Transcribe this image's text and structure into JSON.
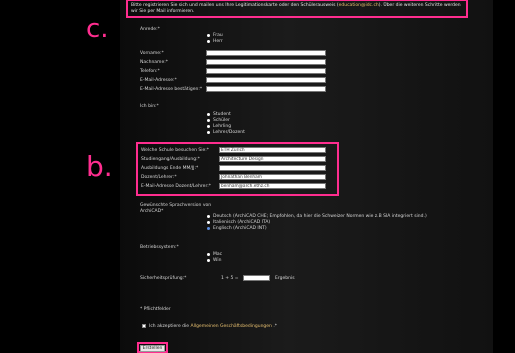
{
  "annotations": {
    "c": "c.",
    "b": "b."
  },
  "notice": {
    "text_before": "Bitte registrieren Sie sich und mailen uns Ihre Legitimationskarte oder den Schülerausweis (",
    "email": "education@idc.ch",
    "text_after": "). Über die weiteren Schritte werden wir Sie per Mail informieren."
  },
  "anrede": {
    "label": "Anrede:*",
    "options": [
      "Frau",
      "Herr"
    ]
  },
  "personal": {
    "vorname": "Vorname:*",
    "nachname": "Nachname:*",
    "telefon": "Telefon:*",
    "email": "E-Mail-Adresse:*",
    "email_confirm": "E-Mail-Adresse bestätigen:*"
  },
  "ichbin": {
    "label": "Ich bin:*",
    "options": [
      "Student",
      "Schüler",
      "Lehrling",
      "Lehrer/Dozent"
    ]
  },
  "school": {
    "schule_label": "Welche Schule besuchen Sie:*",
    "schule_value": "ETH Zurich",
    "studiengang_label": "Studiengang/Ausbildung:*",
    "studiengang_value": "Architecture Design",
    "ende_label": "Ausbildungs Ende MM/JJ:*",
    "ende_value": "",
    "dozent_label": "Dozent/Lehrer:*",
    "dozent_value": "Johnathan Benham",
    "dozent_email_label": "E-Mail-Adresse Dozent/Lehrer:*",
    "dozent_email_value": "benham@arch.ethz.ch"
  },
  "sprache": {
    "label_line1": "Gewünschte Sprachversion von",
    "label_line2": "ArchiCAD*",
    "options": [
      "Deutsch (ArchiCAD CHE; Empfohlen, da hier die Schweizer Normen wie z.B SIA integriert sind.)",
      "Italienisch (ArchiCAD ITA)",
      "Englisch (ArchiCAD INT)"
    ],
    "selected_index": 2
  },
  "betriebssystem": {
    "label": "Betriebssystem:*",
    "options": [
      "Mac",
      "Win"
    ]
  },
  "security": {
    "label": "Sicherheitsprüfung:*",
    "question": "1 + 5 =",
    "result_label": "Ergebnis"
  },
  "required_note": "* Pflichtfelder",
  "agb": {
    "prefix": "Ich akzeptiere die ",
    "link": "Allgemeinen Geschäftsbedingungen",
    "suffix": " .*"
  },
  "submit_label": "Erstellen",
  "colors": {
    "highlight": "#ff2d8f",
    "link": "#e8c070",
    "selected_radio": "#5b8de0"
  }
}
